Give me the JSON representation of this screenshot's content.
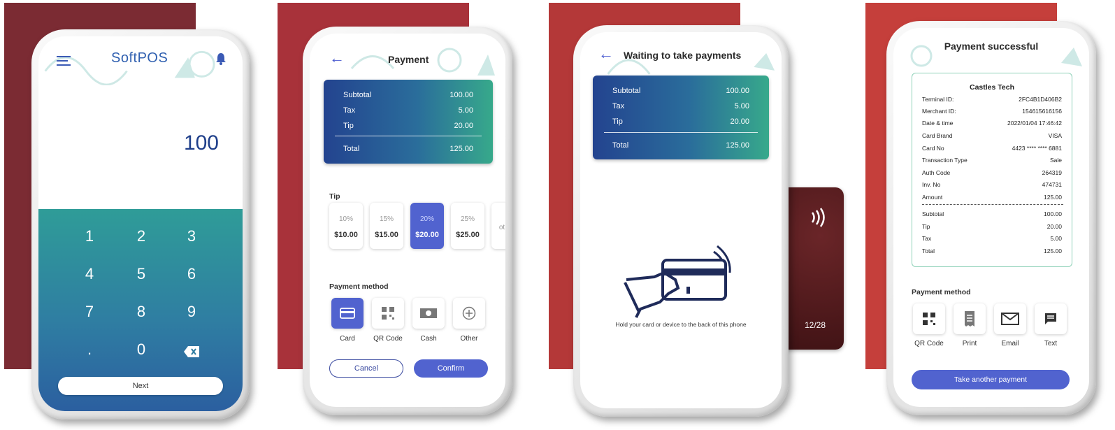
{
  "colors": {
    "bg_red_1": "#7a2a30",
    "bg_red_2": "#a8323a",
    "bg_red_3": "#b83a3a",
    "bg_red_4": "#c8403c",
    "accent": "#5163cf",
    "navy": "#1f3f8a",
    "teal": "#37a98b"
  },
  "screen1": {
    "app_name": "SoftPOS",
    "amount": "100",
    "keys": [
      "1",
      "2",
      "3",
      "4",
      "5",
      "6",
      "7",
      "8",
      "9",
      ".",
      "0"
    ],
    "next_label": "Next",
    "icons": {
      "menu": "menu-icon",
      "bell": "bell-icon",
      "backspace": "backspace-icon"
    }
  },
  "screen2": {
    "title": "Payment",
    "summary": [
      {
        "label": "Subtotal",
        "value": "100.00"
      },
      {
        "label": "Tax",
        "value": "5.00"
      },
      {
        "label": "Tip",
        "value": "20.00"
      }
    ],
    "total": {
      "label": "Total",
      "value": "125.00"
    },
    "tip_label": "Tip",
    "tips": [
      {
        "pct": "10%",
        "amt": "$10.00"
      },
      {
        "pct": "15%",
        "amt": "$15.00"
      },
      {
        "pct": "20%",
        "amt": "$20.00"
      },
      {
        "pct": "25%",
        "amt": "$25.00"
      }
    ],
    "tip_other_partial": "ot",
    "pm_label": "Payment method",
    "methods": [
      "Card",
      "QR Code",
      "Cash",
      "Other"
    ],
    "cancel": "Cancel",
    "confirm": "Confirm"
  },
  "screen3": {
    "title": "Waiting to take payments",
    "summary": [
      {
        "label": "Subtotal",
        "value": "100.00"
      },
      {
        "label": "Tax",
        "value": "5.00"
      },
      {
        "label": "Tip",
        "value": "20.00"
      }
    ],
    "total": {
      "label": "Total",
      "value": "125.00"
    },
    "instruction": "Hold your card or device to the back of this phone",
    "card_expiry": "12/28"
  },
  "screen4": {
    "title": "Payment successful",
    "merchant": "Castles Tech",
    "receipt": [
      {
        "label": "Terminal ID:",
        "value": "2FC4B1D406B2"
      },
      {
        "label": "Merchant ID:",
        "value": "154615616156"
      },
      {
        "label": "Date & time",
        "value": "2022/01/04 17:46:42"
      },
      {
        "label": "Card Brand",
        "value": "VISA"
      },
      {
        "label": "Card No",
        "value": "4423 **** **** 6881"
      },
      {
        "label": "Transaction Type",
        "value": "Sale"
      },
      {
        "label": "Auth Code",
        "value": "264319"
      },
      {
        "label": "Inv. No",
        "value": "474731"
      },
      {
        "label": "Amount",
        "value": "125.00"
      }
    ],
    "totals": [
      {
        "label": "Subtotal",
        "value": "100.00"
      },
      {
        "label": "Tip",
        "value": "20.00"
      },
      {
        "label": "Tax",
        "value": "5.00"
      },
      {
        "label": "Total",
        "value": "125.00"
      }
    ],
    "pm_label": "Payment method",
    "share": [
      "QR Code",
      "Print",
      "Email",
      "Text"
    ],
    "take_another": "Take another payment"
  }
}
